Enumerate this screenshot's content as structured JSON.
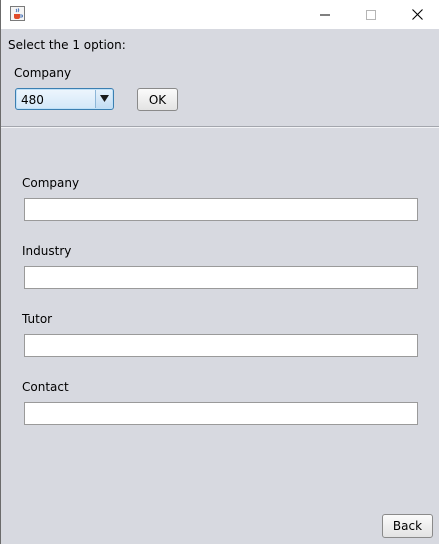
{
  "window": {
    "app_icon": "java-cup-icon",
    "controls": {
      "minimize": "minimize-icon",
      "maximize": "maximize-icon",
      "close": "close-icon"
    }
  },
  "selector": {
    "prompt": "Select the 1 option:",
    "label": "Company",
    "combo_value": "480",
    "combo_arrow": "▼",
    "ok_label": "OK"
  },
  "form": {
    "fields": [
      {
        "label": "Company",
        "value": ""
      },
      {
        "label": "Industry",
        "value": ""
      },
      {
        "label": "Tutor",
        "value": ""
      },
      {
        "label": "Contact",
        "value": ""
      }
    ]
  },
  "footer": {
    "back_label": "Back"
  },
  "colors": {
    "panel_bg": "#d7d9e0",
    "titlebar_bg": "#ffffff",
    "combo_border": "#3c7fb1"
  }
}
